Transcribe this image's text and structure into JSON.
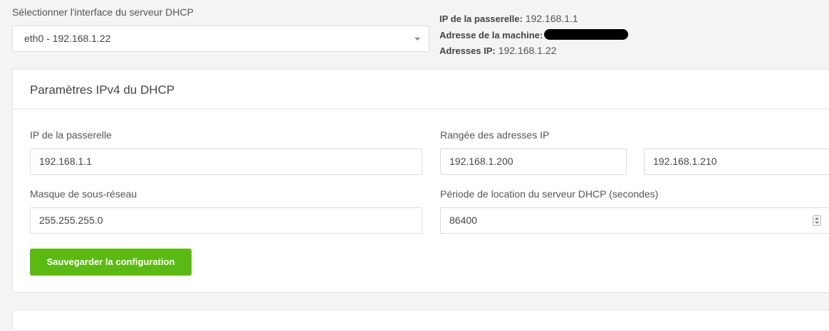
{
  "interface": {
    "label": "Sélectionner l'interface du serveur DHCP",
    "selected": "eth0 - 192.168.1.22"
  },
  "info": {
    "gateway_label": "IP de la passerelle:",
    "gateway_value": "192.168.1.1",
    "machine_label": "Adresse de la machine:",
    "ip_label": "Adresses IP:",
    "ip_value": "192.168.1.22"
  },
  "panel": {
    "title": "Paramètres IPv4 du DHCP",
    "gateway_label": "IP de la passerelle",
    "gateway_value": "192.168.1.1",
    "range_label": "Rangée des adresses IP",
    "range_start": "192.168.1.200",
    "range_end": "192.168.1.210",
    "mask_label": "Masque de sous-réseau",
    "mask_value": "255.255.255.0",
    "lease_label": "Période de location du serveur DHCP (secondes)",
    "lease_value": "86400",
    "save_label": "Sauvegarder la configuration"
  },
  "colors": {
    "accent": "#5cb914"
  }
}
